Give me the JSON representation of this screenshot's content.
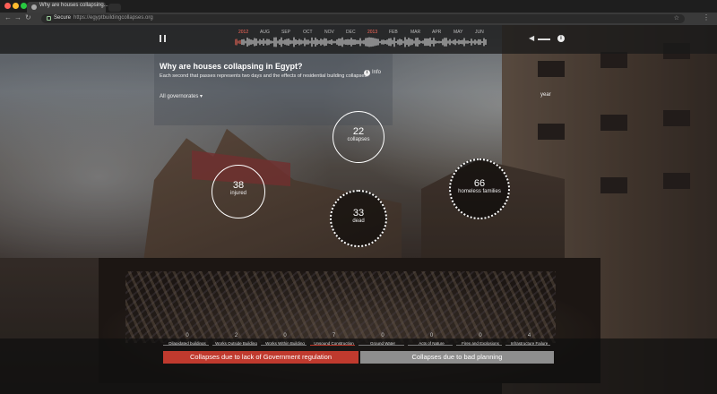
{
  "browser": {
    "tab_title": "Why are houses collapsing...",
    "secure_label": "Secure",
    "url": "https://egyptbuildingcollapses.org"
  },
  "timeline": {
    "labels": [
      {
        "text": "2012",
        "year": true
      },
      {
        "text": "AUG",
        "year": false
      },
      {
        "text": "SEP",
        "year": false
      },
      {
        "text": "OCT",
        "year": false
      },
      {
        "text": "NOV",
        "year": false
      },
      {
        "text": "DEC",
        "year": false
      },
      {
        "text": "2013",
        "year": true
      },
      {
        "text": "FEB",
        "year": false
      },
      {
        "text": "MAR",
        "year": false
      },
      {
        "text": "APR",
        "year": false
      },
      {
        "text": "MAY",
        "year": false
      },
      {
        "text": "JUN",
        "year": false
      }
    ]
  },
  "panel": {
    "headline": "Why are houses collapsing in Egypt?",
    "subtext": "Each second that passes represents two days and the effects of residential building collapses.",
    "info_label": "Info",
    "governorate": "All governorates ▾",
    "year_label": "year"
  },
  "stats": {
    "injured": {
      "value": "38",
      "label": "injured"
    },
    "collapses": {
      "value": "22",
      "label": "collapses"
    },
    "dead": {
      "value": "33",
      "label": "dead"
    },
    "homeless": {
      "value": "66",
      "label": "homeless families"
    }
  },
  "categories": [
    {
      "count": "0",
      "name": "Dilapidated buildings"
    },
    {
      "count": "2",
      "name": "Works Outside Building"
    },
    {
      "count": "0",
      "name": "Works Within Building"
    },
    {
      "count": "7",
      "name": "Unsound Construction"
    },
    {
      "count": "0",
      "name": "Ground Water"
    },
    {
      "count": "0",
      "name": "Acts of Nature"
    },
    {
      "count": "0",
      "name": "Fires and Explosions"
    },
    {
      "count": "4",
      "name": "Infrastructure Failure"
    }
  ],
  "buttons": {
    "government": "Collapses due to lack of Government regulation",
    "planning": "Collapses due to bad planning"
  },
  "colors": {
    "accent_red": "#c03a2e",
    "gray": "#8e8e8e"
  }
}
